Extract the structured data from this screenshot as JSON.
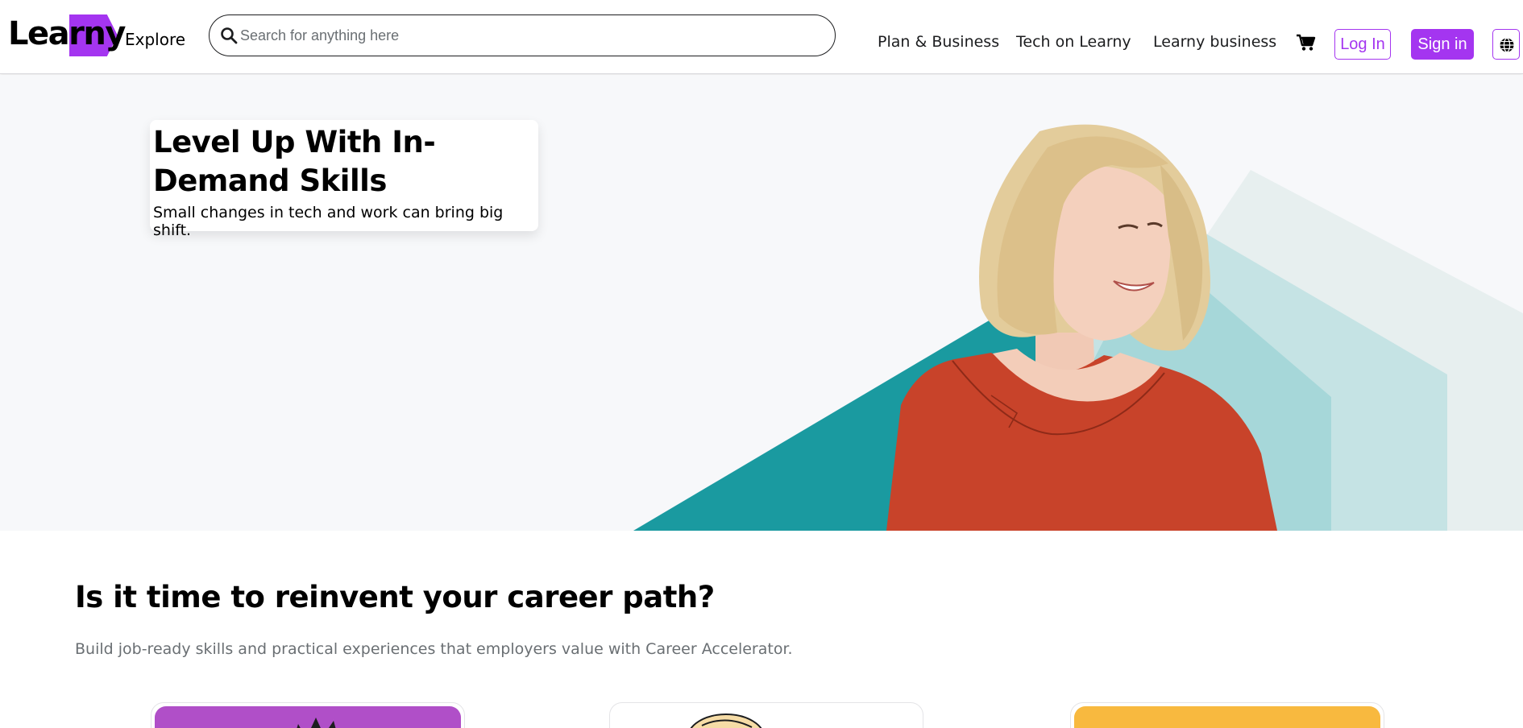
{
  "brand": {
    "logo_text": "Learny",
    "accent": "#a435f0"
  },
  "header": {
    "explore_label": "Explore",
    "search": {
      "placeholder": "Search for anything here",
      "value": ""
    },
    "nav": [
      {
        "label": "Plan & Business"
      },
      {
        "label": "Tech on Learny"
      },
      {
        "label": "Learny business"
      }
    ],
    "cart_icon": "shopping-cart-icon",
    "login_label": "Log In",
    "signin_label": "Sign in",
    "language_icon": "globe-icon"
  },
  "hero": {
    "title": "Level Up With In-Demand Skills",
    "subtitle": "Small changes in tech and work can bring big shift.",
    "colors": {
      "teal": "#1a9aa0",
      "shirt": "#c8432a",
      "hair": "#e3cc9b"
    }
  },
  "career": {
    "title": "Is it time to reinvent your career path?",
    "subtitle": "Build job-ready skills and practical experiences that employers value with Career Accelerator.",
    "cards": [
      {
        "color": "#b04fc8"
      },
      {
        "color": "#ffffff"
      },
      {
        "color": "#f8b93f"
      }
    ]
  }
}
